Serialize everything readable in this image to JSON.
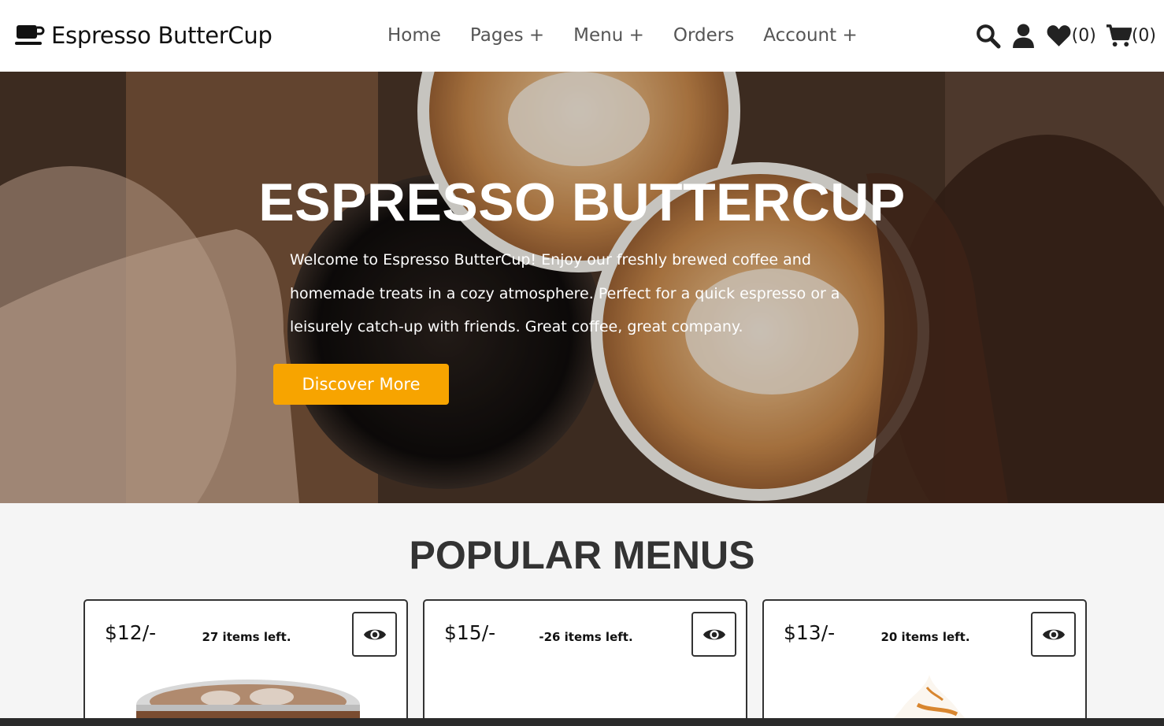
{
  "header": {
    "brand": "Espresso ButterCup",
    "logo_icon": "coffee-cup-icon",
    "nav": [
      {
        "label": "Home"
      },
      {
        "label": "Pages +"
      },
      {
        "label": "Menu +"
      },
      {
        "label": "Orders"
      },
      {
        "label": "Account +"
      }
    ],
    "icons": {
      "search": "search-icon",
      "user": "user-icon",
      "wishlist": "heart-icon",
      "wishlist_count": "(0)",
      "cart": "cart-icon",
      "cart_count": "(0)"
    }
  },
  "hero": {
    "title": "ESPRESSO BUTTERCUP",
    "text": "Welcome to Espresso ButterCup! Enjoy our freshly brewed coffee and homemade treats in a cozy atmosphere. Perfect for a quick espresso or a leisurely catch-up with friends. Great coffee, great company.",
    "button": "Discover More"
  },
  "popular": {
    "title": "POPULAR MENUS",
    "cards": [
      {
        "price": "$12/-",
        "stock": "27 items left.",
        "view_icon": "eye-icon"
      },
      {
        "price": "$15/-",
        "stock": "-26 items left.",
        "view_icon": "eye-icon"
      },
      {
        "price": "$13/-",
        "stock": "20 items left.",
        "view_icon": "eye-icon"
      }
    ]
  },
  "colors": {
    "accent": "#f7a400",
    "text_dark": "#333333",
    "nav_text": "#555555"
  }
}
